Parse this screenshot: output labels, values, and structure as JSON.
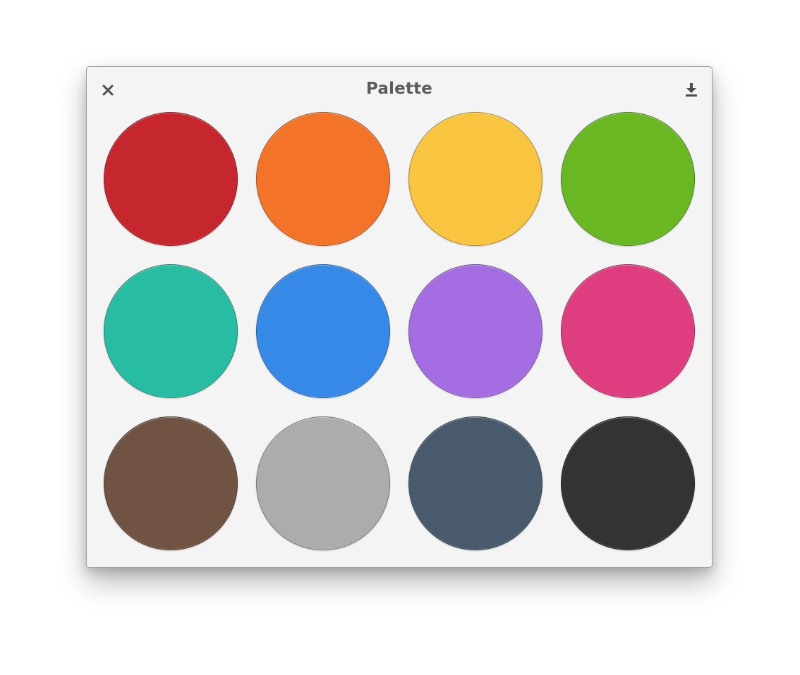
{
  "window": {
    "title": "Palette"
  },
  "toolbar": {
    "close_icon": "close-icon",
    "download_icon": "download-icon"
  },
  "palette": [
    {
      "name": "red",
      "color": "#c6262e"
    },
    {
      "name": "orange",
      "color": "#f37329"
    },
    {
      "name": "yellow",
      "color": "#f9c440"
    },
    {
      "name": "green",
      "color": "#68b723"
    },
    {
      "name": "teal",
      "color": "#28bca3"
    },
    {
      "name": "blue",
      "color": "#3689e6"
    },
    {
      "name": "purple",
      "color": "#a56de2"
    },
    {
      "name": "pink",
      "color": "#de3e80"
    },
    {
      "name": "brown",
      "color": "#715344"
    },
    {
      "name": "gray",
      "color": "#abacae"
    },
    {
      "name": "slate",
      "color": "#485a6c"
    },
    {
      "name": "black",
      "color": "#333333"
    }
  ]
}
